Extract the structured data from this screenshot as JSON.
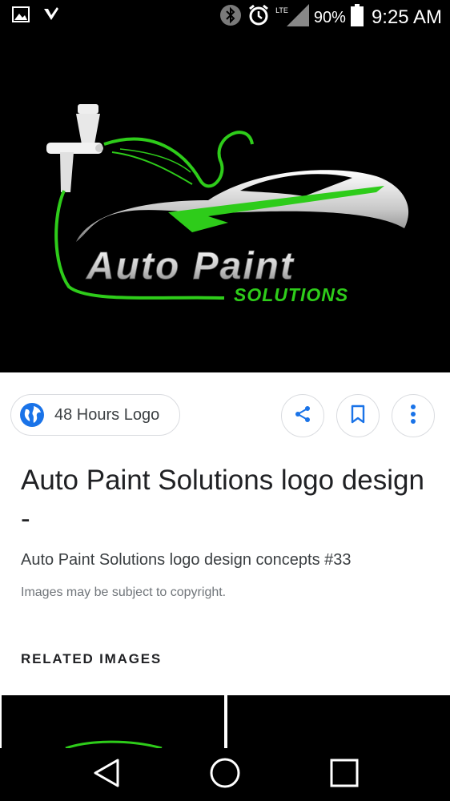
{
  "status_bar": {
    "network": "LTE",
    "battery": "90%",
    "time": "9:25 AM",
    "icons": [
      "gallery-icon",
      "download-icon",
      "bluetooth-icon",
      "alarm-icon",
      "signal-icon",
      "battery-icon"
    ]
  },
  "hero_image": {
    "logo_line1": "Auto Paint",
    "logo_line2": "SOLUTIONS",
    "accent_color": "#2ecc1a"
  },
  "source": {
    "label": "48 Hours Logo",
    "icon": "globe-icon"
  },
  "actions": {
    "share_icon": "share-icon",
    "save_icon": "bookmark-icon",
    "more_icon": "more-vert-icon"
  },
  "details": {
    "title": "Auto Paint Solutions logo design -",
    "subtitle": "Auto Paint Solutions logo design concepts #33",
    "copyright": "Images may be subject to copyright."
  },
  "related": {
    "heading": "RELATED IMAGES"
  },
  "nav_bar": {
    "icons": [
      "back-icon",
      "home-icon",
      "recents-icon"
    ]
  },
  "colors": {
    "accent_blue": "#1a73e8",
    "chip_border": "#dadce0"
  }
}
